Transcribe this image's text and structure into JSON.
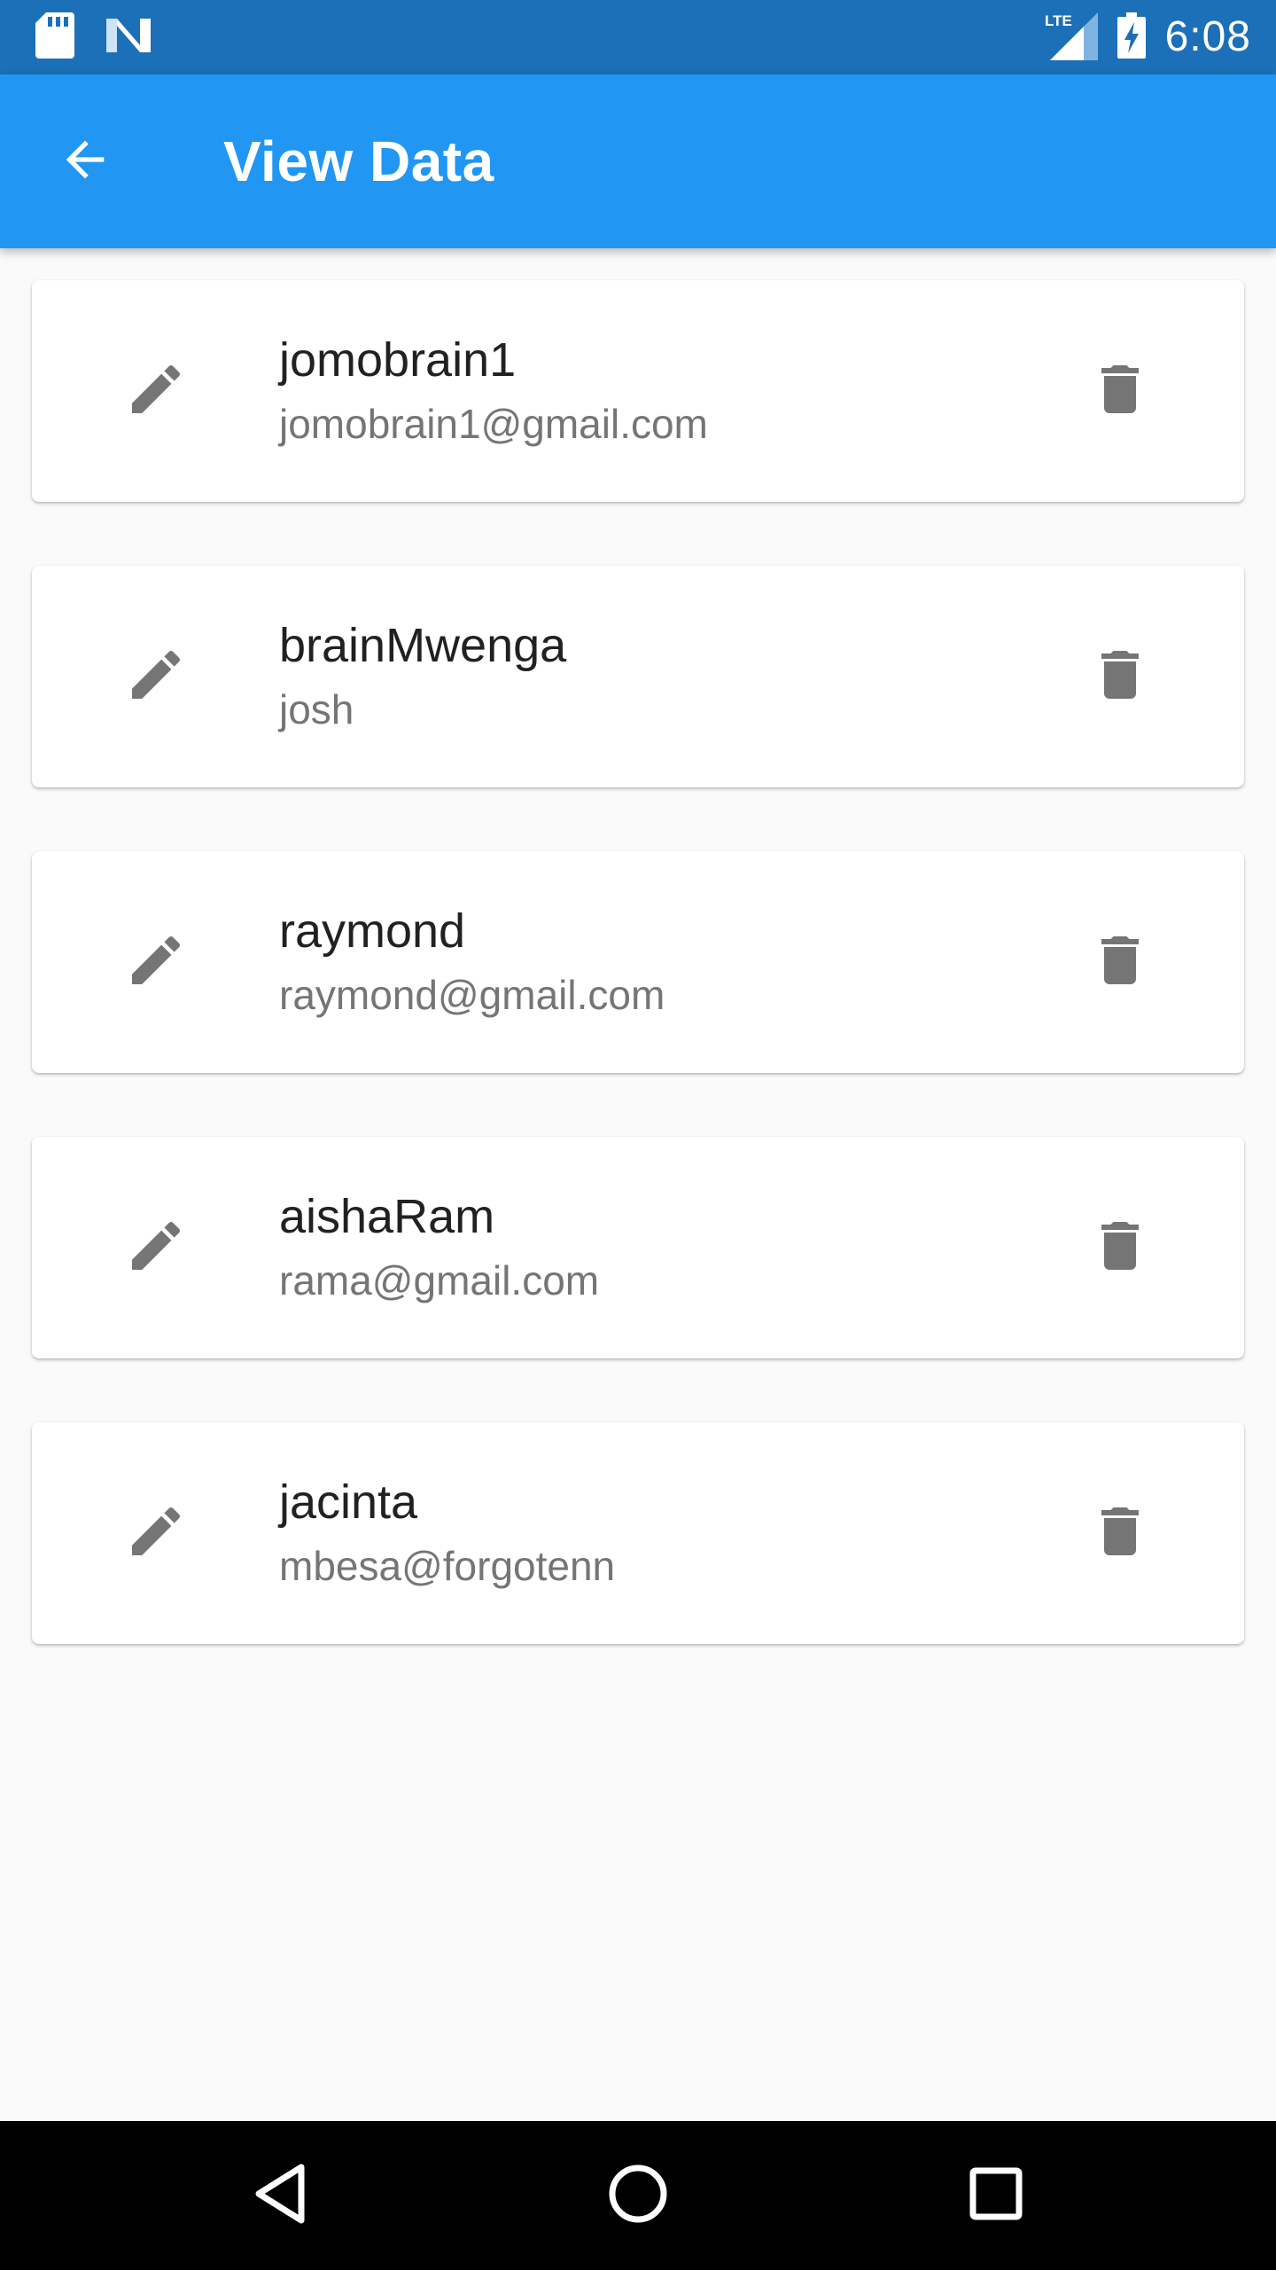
{
  "status_bar": {
    "time": "6:08",
    "network_label": "LTE",
    "icons": [
      "sd-card-icon",
      "n-notification-icon",
      "lte-signal-icon",
      "battery-charging-icon"
    ]
  },
  "app_bar": {
    "title": "View Data",
    "back_icon": "arrow-back-icon",
    "color": "#2196f3"
  },
  "records": [
    {
      "name": "jomobrain1",
      "email": "jomobrain1@gmail.com"
    },
    {
      "name": "brainMwenga",
      "email": "josh"
    },
    {
      "name": "raymond",
      "email": "raymond@gmail.com"
    },
    {
      "name": "aishaRam",
      "email": "rama@gmail.com"
    },
    {
      "name": "jacinta",
      "email": "mbesa@forgotenn"
    }
  ],
  "record_icons": {
    "edit": "pencil-icon",
    "delete": "trash-icon"
  },
  "nav_bar": {
    "icons": [
      "back-triangle-icon",
      "home-circle-icon",
      "recents-square-icon"
    ]
  },
  "colors": {
    "status_bar": "#1b70b8",
    "app_bar": "#2196f3",
    "icon_grey": "#757575",
    "background": "#fafafa"
  }
}
